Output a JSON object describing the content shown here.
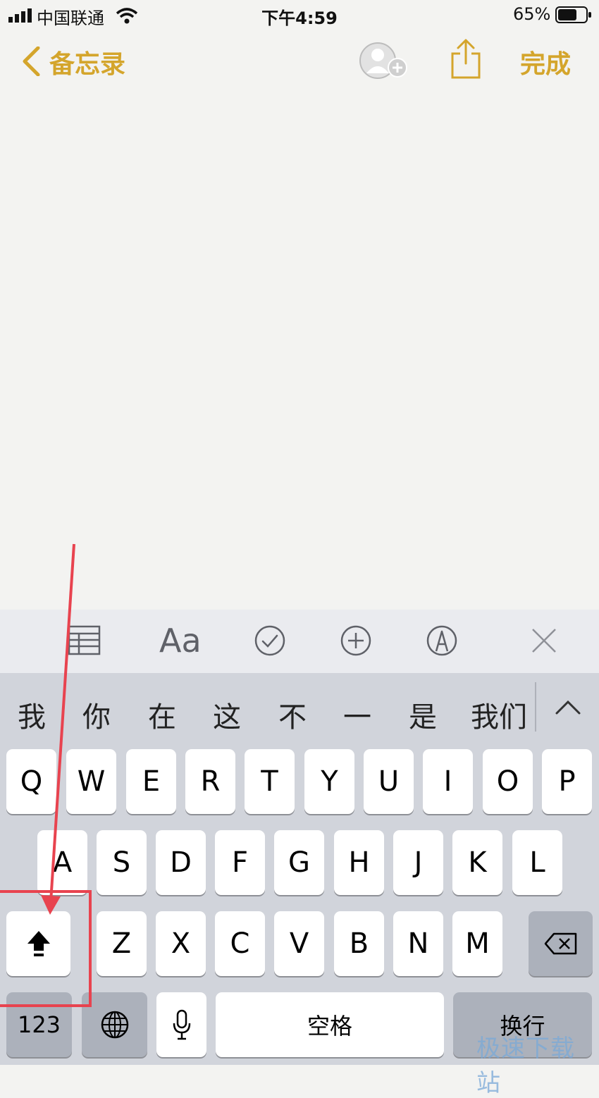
{
  "status_bar": {
    "carrier": "中国联通",
    "time": "下午4:59",
    "battery": "65%"
  },
  "nav": {
    "back_label": "备忘录",
    "done_label": "完成"
  },
  "toolbar": {
    "text_style_label": "Aa"
  },
  "candidates": [
    "我",
    "你",
    "在",
    "这",
    "不",
    "一",
    "是",
    "我们"
  ],
  "keyboard": {
    "row1": [
      "Q",
      "W",
      "E",
      "R",
      "T",
      "Y",
      "U",
      "I",
      "O",
      "P"
    ],
    "row2": [
      "A",
      "S",
      "D",
      "F",
      "G",
      "H",
      "J",
      "K",
      "L"
    ],
    "row3": [
      "Z",
      "X",
      "C",
      "V",
      "B",
      "N",
      "M"
    ],
    "numbers_label": "123",
    "space_label": "空格",
    "return_label": "换行"
  },
  "icons": [
    "signal-icon",
    "wifi-icon",
    "battery-icon",
    "chevron-left-icon",
    "add-person-icon",
    "share-icon",
    "table-icon",
    "checklist-icon",
    "add-icon",
    "markup-icon",
    "close-icon",
    "chevron-up-icon",
    "shift-icon",
    "delete-icon",
    "globe-icon",
    "microphone-icon"
  ],
  "accent_color": "#d4a52c",
  "annotation_color": "#e8434f",
  "watermark": "极速下载站"
}
